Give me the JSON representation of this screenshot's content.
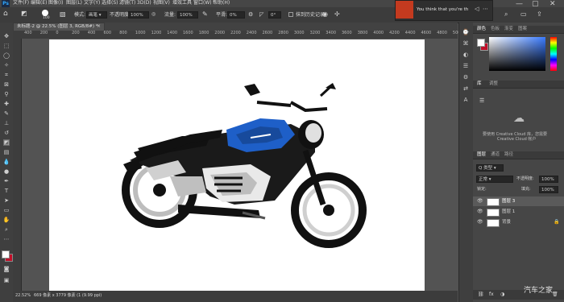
{
  "menubar": {
    "logo": "Ps",
    "items": [
      "文件(F)",
      "编辑(E)",
      "图像(I)",
      "图层(L)",
      "文字(Y)",
      "选择(S)",
      "滤镜(T)",
      "3D(D)",
      "视图(V)",
      "增效工具",
      "窗口(W)",
      "帮助(H)"
    ]
  },
  "options": {
    "brush_size": "100",
    "mode_label": "模式:",
    "mode_value": "画笔",
    "opacity_label": "不透明度:",
    "opacity_value": "100%",
    "flow_label": "流量:",
    "flow_value": "100%",
    "smoothing_label": "平滑:",
    "smoothing_value": "0%",
    "angle_value": "0°",
    "erase_history": "抹到历史记录"
  },
  "notification": {
    "text": "You think that you're th"
  },
  "document": {
    "tab_title": "未标题-2 @ 22.5% (图层 3, RGB/8#) *"
  },
  "ruler": {
    "h_ticks": [
      "400",
      "200",
      "0",
      "200",
      "400",
      "600",
      "800",
      "1000",
      "1200",
      "1400",
      "1600",
      "1800",
      "2000",
      "2200",
      "2400",
      "2600",
      "2800",
      "3000",
      "3200",
      "3400",
      "3600",
      "3800",
      "4000",
      "4200",
      "4400",
      "4600",
      "4800",
      "5000"
    ]
  },
  "status": {
    "zoom": "22.52%",
    "doc_info": "669 像素 x 3779 像素 (1 (9.99 ppi)"
  },
  "panels": {
    "color_tabs": [
      "颜色",
      "色板",
      "渐变",
      "图案"
    ],
    "properties_tabs": [
      "库",
      "调整"
    ],
    "library_message": "要使用 Creative Cloud 库，您需要",
    "library_message_2": "Creative Cloud 帐户",
    "layers_tabs": [
      "图层",
      "通道",
      "路径"
    ],
    "filter_label": "Q 类型",
    "blend_mode": "正常",
    "opacity_label": "不透明度:",
    "opacity_value": "100%",
    "lock_label": "锁定:",
    "fill_label": "填充:",
    "fill_value": "100%",
    "layers": [
      {
        "name": "图层 3",
        "selected": true
      },
      {
        "name": "图层 1",
        "selected": false
      },
      {
        "name": "背景",
        "selected": false
      }
    ]
  },
  "watermark": "汽车之家",
  "colors": {
    "accent_blue": "#1e5fc8",
    "foreground": "#ffffff",
    "background": "#c0102a"
  }
}
